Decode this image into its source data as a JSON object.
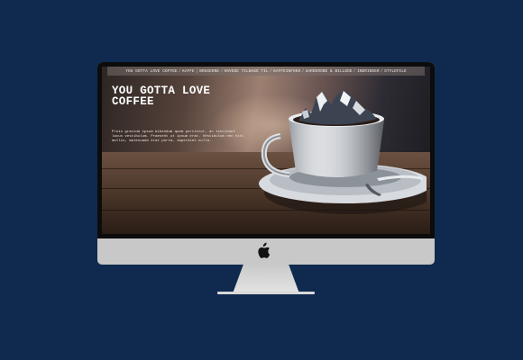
{
  "navigation": {
    "items": [
      "YOU GOTTA LOVE COFFEE",
      "KAFFE",
      "BRUGERNE",
      "HOVEDE TILBAGE TIL",
      "KAFFEINFOKS",
      "GARDEROBE & BILLEDE",
      "INDRINGER",
      "STYLEFILE"
    ]
  },
  "hero": {
    "title_lines": [
      "YOU GOTTA LOVE",
      "COFFEE"
    ],
    "body": "Proin gravida ipsum bibendum quam porttitor, ac tincidunt lacus vestibulum. Praesent ut ipsum erat. Vestibulum nec nisl mollis, malesuada erat porta, imperdiet nulla."
  },
  "device": {
    "logo_icon": "apple-logo-icon"
  },
  "colors": {
    "background": "#0f2a4e",
    "monitor_body": "#c8c8c8",
    "bezel": "#0c0c0c",
    "nav_bar": "#78706c"
  }
}
